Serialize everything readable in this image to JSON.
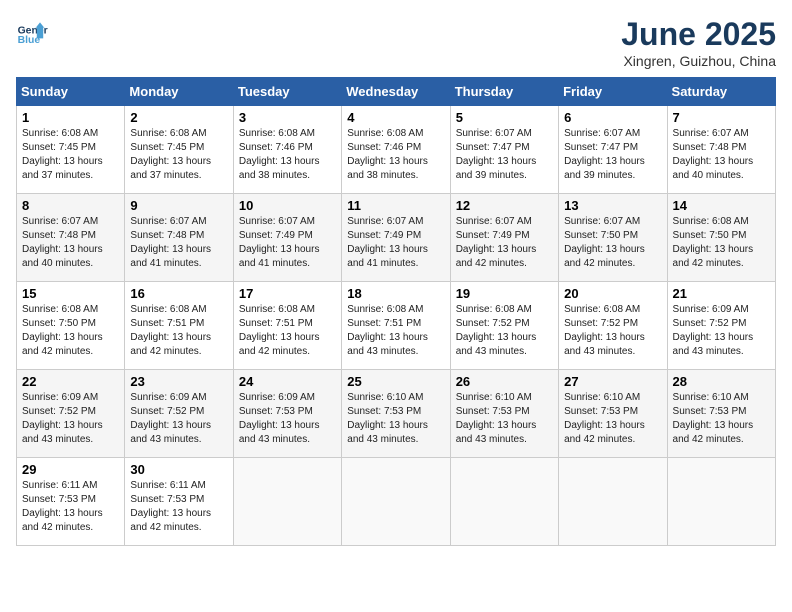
{
  "logo": {
    "line1": "General",
    "line2": "Blue"
  },
  "title": "June 2025",
  "location": "Xingren, Guizhou, China",
  "days_of_week": [
    "Sunday",
    "Monday",
    "Tuesday",
    "Wednesday",
    "Thursday",
    "Friday",
    "Saturday"
  ],
  "weeks": [
    [
      {
        "day": 1,
        "sunrise": "6:08 AM",
        "sunset": "7:45 PM",
        "daylight": "13 hours and 37 minutes."
      },
      {
        "day": 2,
        "sunrise": "6:08 AM",
        "sunset": "7:45 PM",
        "daylight": "13 hours and 37 minutes."
      },
      {
        "day": 3,
        "sunrise": "6:08 AM",
        "sunset": "7:46 PM",
        "daylight": "13 hours and 38 minutes."
      },
      {
        "day": 4,
        "sunrise": "6:08 AM",
        "sunset": "7:46 PM",
        "daylight": "13 hours and 38 minutes."
      },
      {
        "day": 5,
        "sunrise": "6:07 AM",
        "sunset": "7:47 PM",
        "daylight": "13 hours and 39 minutes."
      },
      {
        "day": 6,
        "sunrise": "6:07 AM",
        "sunset": "7:47 PM",
        "daylight": "13 hours and 39 minutes."
      },
      {
        "day": 7,
        "sunrise": "6:07 AM",
        "sunset": "7:48 PM",
        "daylight": "13 hours and 40 minutes."
      }
    ],
    [
      {
        "day": 8,
        "sunrise": "6:07 AM",
        "sunset": "7:48 PM",
        "daylight": "13 hours and 40 minutes."
      },
      {
        "day": 9,
        "sunrise": "6:07 AM",
        "sunset": "7:48 PM",
        "daylight": "13 hours and 41 minutes."
      },
      {
        "day": 10,
        "sunrise": "6:07 AM",
        "sunset": "7:49 PM",
        "daylight": "13 hours and 41 minutes."
      },
      {
        "day": 11,
        "sunrise": "6:07 AM",
        "sunset": "7:49 PM",
        "daylight": "13 hours and 41 minutes."
      },
      {
        "day": 12,
        "sunrise": "6:07 AM",
        "sunset": "7:49 PM",
        "daylight": "13 hours and 42 minutes."
      },
      {
        "day": 13,
        "sunrise": "6:07 AM",
        "sunset": "7:50 PM",
        "daylight": "13 hours and 42 minutes."
      },
      {
        "day": 14,
        "sunrise": "6:08 AM",
        "sunset": "7:50 PM",
        "daylight": "13 hours and 42 minutes."
      }
    ],
    [
      {
        "day": 15,
        "sunrise": "6:08 AM",
        "sunset": "7:50 PM",
        "daylight": "13 hours and 42 minutes."
      },
      {
        "day": 16,
        "sunrise": "6:08 AM",
        "sunset": "7:51 PM",
        "daylight": "13 hours and 42 minutes."
      },
      {
        "day": 17,
        "sunrise": "6:08 AM",
        "sunset": "7:51 PM",
        "daylight": "13 hours and 42 minutes."
      },
      {
        "day": 18,
        "sunrise": "6:08 AM",
        "sunset": "7:51 PM",
        "daylight": "13 hours and 43 minutes."
      },
      {
        "day": 19,
        "sunrise": "6:08 AM",
        "sunset": "7:52 PM",
        "daylight": "13 hours and 43 minutes."
      },
      {
        "day": 20,
        "sunrise": "6:08 AM",
        "sunset": "7:52 PM",
        "daylight": "13 hours and 43 minutes."
      },
      {
        "day": 21,
        "sunrise": "6:09 AM",
        "sunset": "7:52 PM",
        "daylight": "13 hours and 43 minutes."
      }
    ],
    [
      {
        "day": 22,
        "sunrise": "6:09 AM",
        "sunset": "7:52 PM",
        "daylight": "13 hours and 43 minutes."
      },
      {
        "day": 23,
        "sunrise": "6:09 AM",
        "sunset": "7:52 PM",
        "daylight": "13 hours and 43 minutes."
      },
      {
        "day": 24,
        "sunrise": "6:09 AM",
        "sunset": "7:53 PM",
        "daylight": "13 hours and 43 minutes."
      },
      {
        "day": 25,
        "sunrise": "6:10 AM",
        "sunset": "7:53 PM",
        "daylight": "13 hours and 43 minutes."
      },
      {
        "day": 26,
        "sunrise": "6:10 AM",
        "sunset": "7:53 PM",
        "daylight": "13 hours and 43 minutes."
      },
      {
        "day": 27,
        "sunrise": "6:10 AM",
        "sunset": "7:53 PM",
        "daylight": "13 hours and 42 minutes."
      },
      {
        "day": 28,
        "sunrise": "6:10 AM",
        "sunset": "7:53 PM",
        "daylight": "13 hours and 42 minutes."
      }
    ],
    [
      {
        "day": 29,
        "sunrise": "6:11 AM",
        "sunset": "7:53 PM",
        "daylight": "13 hours and 42 minutes."
      },
      {
        "day": 30,
        "sunrise": "6:11 AM",
        "sunset": "7:53 PM",
        "daylight": "13 hours and 42 minutes."
      },
      null,
      null,
      null,
      null,
      null
    ]
  ]
}
